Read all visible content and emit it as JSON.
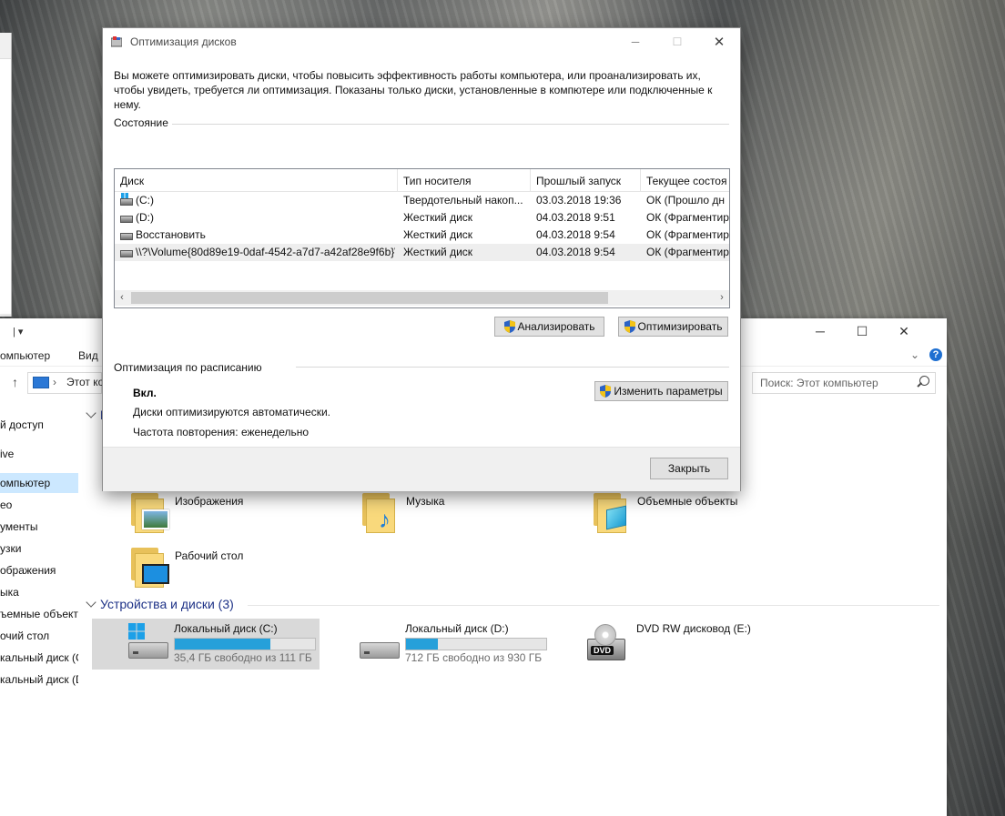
{
  "dialog": {
    "title": "Оптимизация дисков",
    "description": "Вы можете оптимизировать диски, чтобы повысить эффективность работы  компьютера, или проанализировать их, чтобы увидеть, требуется ли оптимизация. Показаны только диски, установленные в компютере или подключенные к нему.",
    "status_label": "Состояние",
    "columns": [
      "Диск",
      "Тип носителя",
      "Прошлый запуск",
      "Текущее состоя"
    ],
    "rows": [
      {
        "disk": "(C:)",
        "media": "Твердотельный накоп...",
        "last_run": "03.03.2018 19:36",
        "status": "ОК (Прошло дн",
        "icon": "windows-drive-icon"
      },
      {
        "disk": "(D:)",
        "media": "Жесткий диск",
        "last_run": "04.03.2018 9:51",
        "status": "ОК (Фрагментир",
        "icon": "drive-icon"
      },
      {
        "disk": "Восстановить",
        "media": "Жесткий диск",
        "last_run": "04.03.2018 9:54",
        "status": "ОК (Фрагментир",
        "icon": "drive-icon"
      },
      {
        "disk": "\\\\?\\Volume{80d89e19-0daf-4542-a7d7-a42af28e9f6b}\\",
        "media": "Жесткий диск",
        "last_run": "04.03.2018 9:54",
        "status": "ОК (Фрагментир",
        "icon": "drive-icon"
      }
    ],
    "analyze_button": "Анализировать",
    "optimize_button": "Оптимизировать",
    "schedule_label": "Оптимизация по расписанию",
    "schedule_state": "Вкл.",
    "schedule_auto": "Диски оптимизируются автоматически.",
    "schedule_freq": "Частота повторения: еженедельно",
    "change_settings_button": "Изменить параметры",
    "close_button": "Закрыть"
  },
  "explorer": {
    "quick_access_arrow": "|  ▾",
    "ribbon_tab": "омпьютер",
    "ribbon_tab2": "Вид",
    "address_text": "Этот ко",
    "search_placeholder": "Поиск: Этот компьютер",
    "nav_items": [
      "й доступ",
      "ive",
      "омпьютер",
      "ео",
      "ументы",
      "узки",
      "ображения",
      "ыка",
      "ъемные объекты",
      "очий стол",
      "кальный диск (C",
      "кальный диск (D"
    ],
    "nav_selected_index": 2,
    "folders_group_partial": "П",
    "folders": [
      {
        "name": "Изображения",
        "icon": "pictures-folder-icon"
      },
      {
        "name": "Музыка",
        "icon": "music-folder-icon"
      },
      {
        "name": "Объемные объекты",
        "icon": "3d-objects-folder-icon"
      },
      {
        "name": "Рабочий стол",
        "icon": "desktop-folder-icon"
      }
    ],
    "devices_group": "Устройства и диски (3)",
    "drives": [
      {
        "name": "Локальный диск (C:)",
        "free": "35,4 ГБ свободно из 111 ГБ",
        "used_fraction": 0.68
      },
      {
        "name": "Локальный диск (D:)",
        "free": "712 ГБ свободно из 930 ГБ",
        "used_fraction": 0.23
      },
      {
        "name": "DVD RW дисковод (E:)",
        "dvd_badge": "DVD"
      }
    ]
  },
  "colors": {
    "accent": "#26a0da",
    "selection": "#cce8ff",
    "group_header": "#1e3287"
  }
}
